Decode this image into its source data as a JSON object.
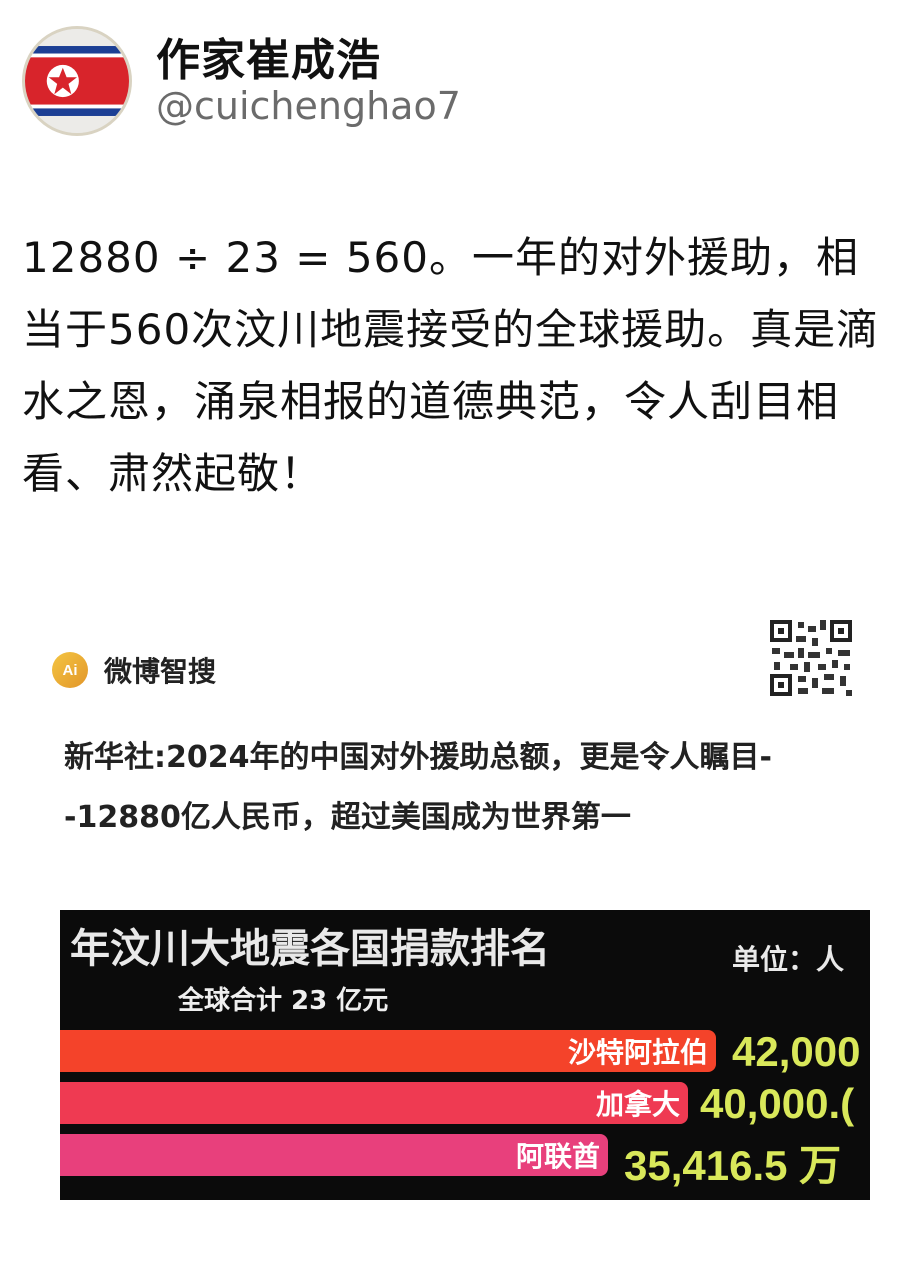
{
  "post": {
    "display_name": "作家崔成浩",
    "handle": "@cuichenghao7",
    "text": "12880 ÷ 23 = 560。一年的对外援助，相当于560次汶川地震接受的全球援助。真是滴水之恩，涌泉相报的道德典范，令人刮目相看、肃然起敬！"
  },
  "card": {
    "ai_badge": "Ai",
    "brand": "微博智搜",
    "text": "新华社:2024年的中国对外援助总额，更是令人瞩目--12880亿人民币，超过美国成为世界第一"
  },
  "ranking": {
    "title": "年汶川大地震各国捐款排名",
    "unit": "单位：人",
    "total": "全球合计 23 亿元",
    "items": [
      {
        "country": "沙特阿拉伯",
        "value": "42,000",
        "color": "#f4432a"
      },
      {
        "country": "加拿大",
        "value": "40,000.(",
        "color": "#ef3a52"
      },
      {
        "country": "阿联酋",
        "value": "35,416.5 万",
        "color": "#e8407c"
      }
    ]
  },
  "colors": {
    "flag_red": "#d8242b",
    "flag_blue": "#1c3f94",
    "value_yellow": "#d9e85a"
  }
}
